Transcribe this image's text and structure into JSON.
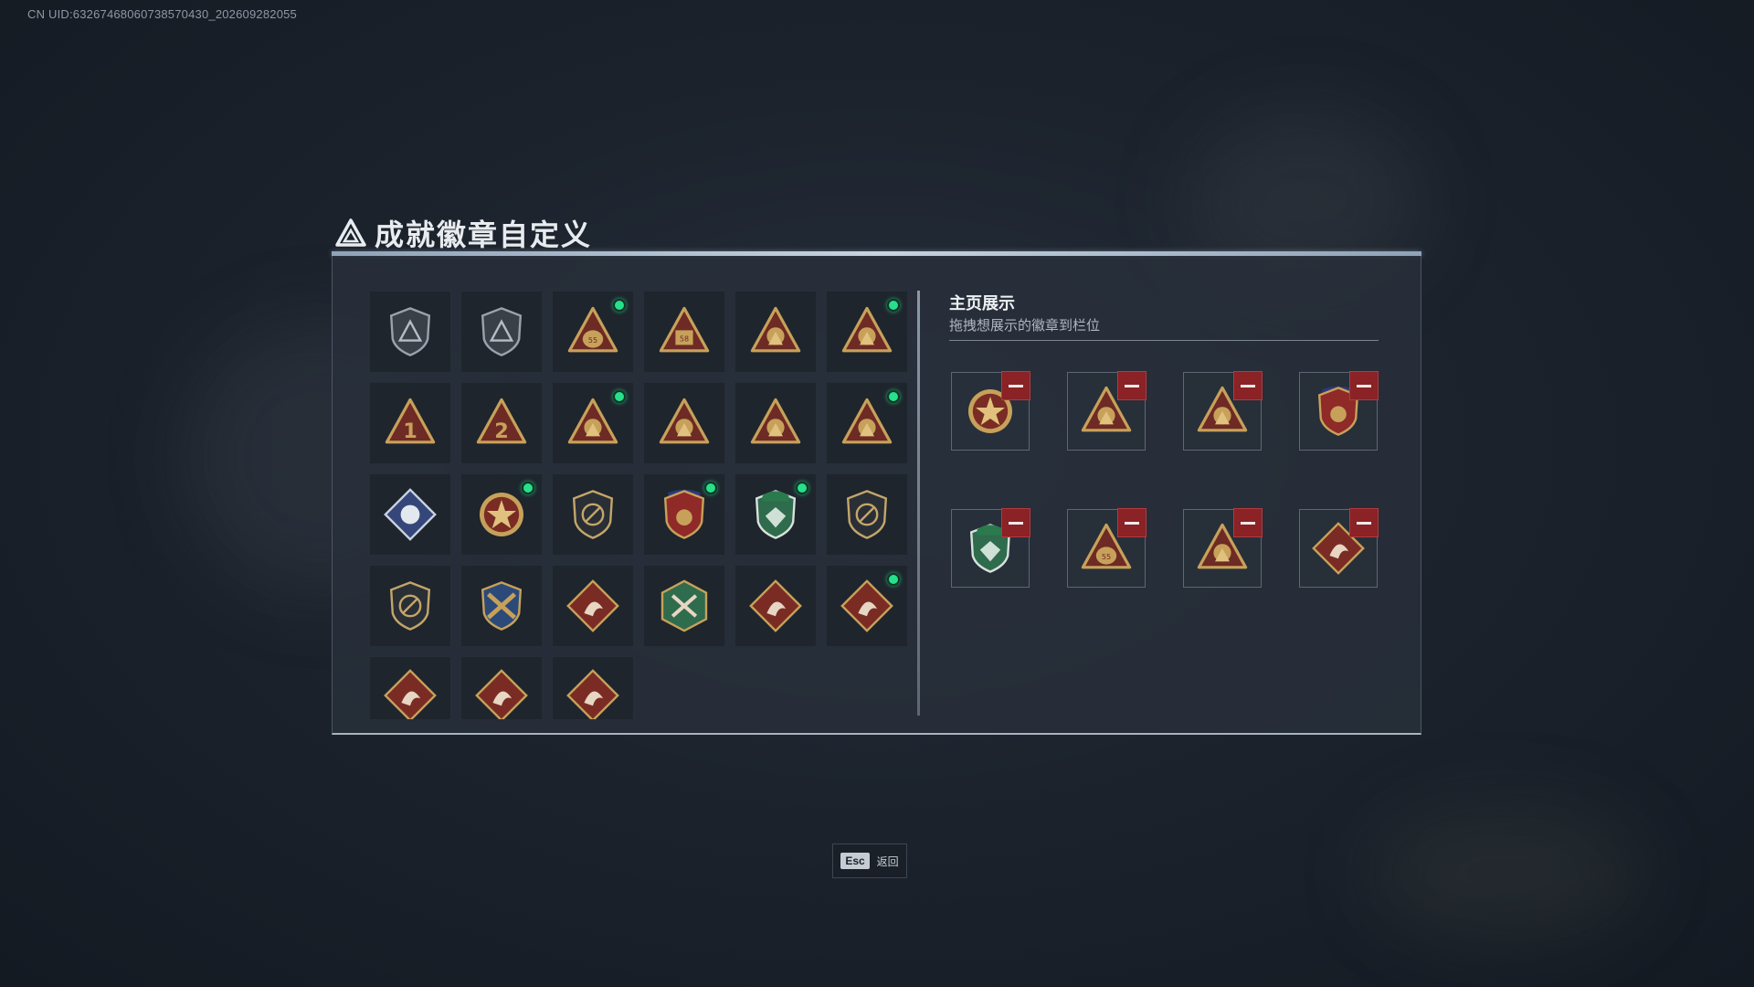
{
  "uid_text": "CN UID:63267468060738570430_202609282055",
  "title": "成就徽章自定义",
  "colors": {
    "accent_new": "#27e08a",
    "remove": "#8a2226",
    "gold": "#c7a15a",
    "maroon": "#6e2a24",
    "green": "#2f6b4d"
  },
  "inventory": [
    {
      "icon": "grey-shield-emblem-icon",
      "new": false
    },
    {
      "icon": "grey-helicopter-badge-icon",
      "new": false
    },
    {
      "icon": "gold-triangle-sack-55-icon",
      "new": true
    },
    {
      "icon": "gold-triangle-58-badge-icon",
      "new": false
    },
    {
      "icon": "gold-triangle-helmet-icon",
      "new": false
    },
    {
      "icon": "gold-triangle-dragon-icon",
      "new": true
    },
    {
      "icon": "gold-triangle-rank1-icon",
      "new": false
    },
    {
      "icon": "gold-triangle-rank2-icon",
      "new": false
    },
    {
      "icon": "gold-triangle-flower-icon",
      "new": true
    },
    {
      "icon": "gold-triangle-soldier-icon",
      "new": false
    },
    {
      "icon": "gold-triangle-squad-icon",
      "new": false
    },
    {
      "icon": "gold-triangle-tower-icon",
      "new": true
    },
    {
      "icon": "blue-diamond-tiger-icon",
      "new": false
    },
    {
      "icon": "red-star-medal-icon",
      "new": true
    },
    {
      "icon": "gold-shield-wings-icon",
      "new": false
    },
    {
      "icon": "stars-crest-shield-icon",
      "new": true
    },
    {
      "icon": "green-beret-shield-icon",
      "new": true
    },
    {
      "icon": "shield-no-weapon-icon",
      "new": false
    },
    {
      "icon": "shield-no-rifle-icon",
      "new": false
    },
    {
      "icon": "crossed-rifles-shield-icon",
      "new": false
    },
    {
      "icon": "red-diamond-wolf-icon",
      "new": false
    },
    {
      "icon": "green-hexagon-crossed-knives-icon",
      "new": false
    },
    {
      "icon": "red-diamond-dragon-icon",
      "new": false
    },
    {
      "icon": "red-diamond-dragon-alt-icon",
      "new": true
    },
    {
      "icon": "red-diamond-runner-icon",
      "new": false
    },
    {
      "icon": "red-diamond-beast-icon",
      "new": false
    },
    {
      "icon": "red-diamond-tools-icon",
      "new": false
    }
  ],
  "showcase": {
    "title": "主页展示",
    "subtitle": "拖拽想展示的徽章到栏位",
    "slots": [
      {
        "icon": "red-star-medal-icon"
      },
      {
        "icon": "gold-triangle-flower-icon"
      },
      {
        "icon": "gold-triangle-tower-icon"
      },
      {
        "icon": "stars-crest-shield-icon"
      },
      {
        "icon": "green-beret-shield-icon"
      },
      {
        "icon": "gold-triangle-sack-55-icon"
      },
      {
        "icon": "gold-triangle-dragon-icon"
      },
      {
        "icon": "red-diamond-dragon-alt-icon"
      }
    ]
  },
  "footer": {
    "esc_key": "Esc",
    "esc_label": "返回"
  }
}
